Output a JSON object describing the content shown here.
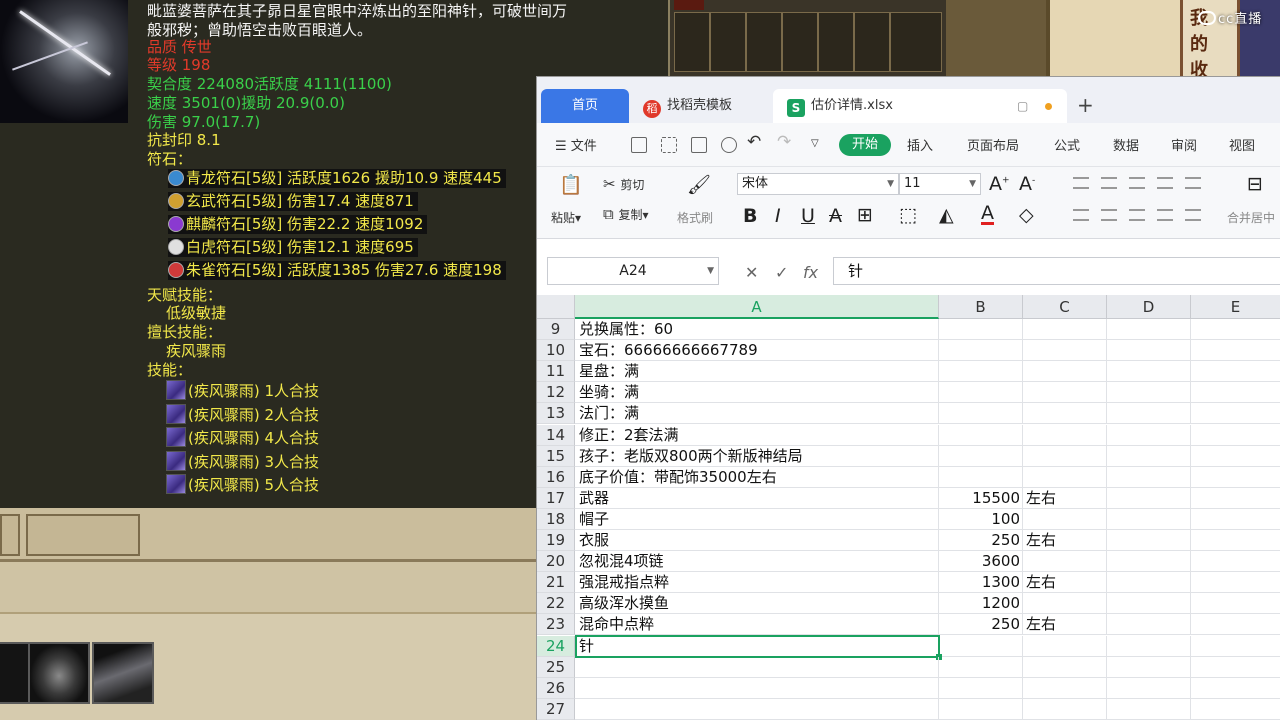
{
  "game": {
    "tooltip": {
      "desc_line1": "毗蓝婆菩萨在其子昴日星官眼中淬炼出的至阳神针，可破世间万",
      "desc_line2": "般邪秽；曾助悟空击败百眼道人。",
      "quality": "品质  传世",
      "level": "等级  198",
      "affinity": "契合度     224080活跃度  4111(1100)",
      "speed": "速度     3501(0)援助     20.9(0.0)",
      "damage": "伤害    97.0(17.7)",
      "resist_seal": "抗封印 8.1",
      "runes_label": "符石：",
      "runes": [
        {
          "text": "青龙符石[5级] 活跃度1626 援助10.9 速度445",
          "color": "#3a8ad0"
        },
        {
          "text": "玄武符石[5级] 伤害17.4 速度871",
          "color": "#d0a030"
        },
        {
          "text": "麒麟符石[5级] 伤害22.2 速度1092",
          "color": "#8a3ad0"
        },
        {
          "text": "白虎符石[5级] 伤害12.1 速度695",
          "color": "#e0e0e0"
        },
        {
          "text": "朱雀符石[5级] 活跃度1385 伤害27.6 速度198",
          "color": "#d03a3a"
        }
      ],
      "talent_label": "天赋技能：",
      "talent_value": "低级敏捷",
      "specialty_label": "擅长技能：",
      "specialty_value": "疾风骤雨",
      "skills_label": "技能：",
      "skills": [
        "(疾风骤雨) 1人合技",
        "(疾风骤雨) 2人合技",
        "(疾风骤雨) 4人合技",
        "(疾风骤雨) 3人合技",
        "(疾风骤雨) 5人合技"
      ]
    },
    "scroll_chars": [
      "我",
      "的",
      "收"
    ],
    "live_logo": "cc直播"
  },
  "wps": {
    "tabs": {
      "home": "首页",
      "templates": "找稻壳模板",
      "file": "估价详情.xlsx",
      "file_icon": "S",
      "templates_icon": "稻"
    },
    "menu": {
      "file": "文件",
      "start": "开始",
      "insert": "插入",
      "page_layout": "页面布局",
      "formula": "公式",
      "data": "数据",
      "review": "审阅",
      "view": "视图"
    },
    "ribbon": {
      "paste": "粘贴",
      "cut": "剪切",
      "copy": "复制",
      "format_painter": "格式刷",
      "font_name": "宋体",
      "font_size": "11",
      "merge": "合并居中"
    },
    "formula_bar": {
      "cell_ref": "A24",
      "content": "针"
    },
    "columns": [
      "A",
      "B",
      "C",
      "D",
      "E"
    ],
    "selected_column": "A",
    "rows": [
      {
        "num": "9",
        "a": "兑换属性：60",
        "b": "",
        "c": ""
      },
      {
        "num": "10",
        "a": "宝石：66666666667789",
        "b": "",
        "c": ""
      },
      {
        "num": "11",
        "a": "星盘：满",
        "b": "",
        "c": ""
      },
      {
        "num": "12",
        "a": "坐骑：满",
        "b": "",
        "c": ""
      },
      {
        "num": "13",
        "a": "法门：满",
        "b": "",
        "c": ""
      },
      {
        "num": "14",
        "a": "修正：2套法满",
        "b": "",
        "c": ""
      },
      {
        "num": "15",
        "a": "孩子：老版双800两个新版神结局",
        "b": "",
        "c": ""
      },
      {
        "num": "16",
        "a": "底子价值：带配饰35000左右",
        "b": "",
        "c": ""
      },
      {
        "num": "17",
        "a": "武器",
        "b": "15500",
        "c": "左右"
      },
      {
        "num": "18",
        "a": "帽子",
        "b": "100",
        "c": ""
      },
      {
        "num": "19",
        "a": "衣服",
        "b": "250",
        "c": "左右"
      },
      {
        "num": "20",
        "a": "忽视混4项链",
        "b": "3600",
        "c": ""
      },
      {
        "num": "21",
        "a": "强混戒指点粹",
        "b": "1300",
        "c": "左右"
      },
      {
        "num": "22",
        "a": "高级浑水摸鱼",
        "b": "1200",
        "c": ""
      },
      {
        "num": "23",
        "a": "混命中点粹",
        "b": "250",
        "c": "左右"
      },
      {
        "num": "24",
        "a": "针",
        "b": "",
        "c": ""
      },
      {
        "num": "25",
        "a": "",
        "b": "",
        "c": ""
      },
      {
        "num": "26",
        "a": "",
        "b": "",
        "c": ""
      },
      {
        "num": "27",
        "a": "",
        "b": "",
        "c": ""
      }
    ],
    "active_row": "24",
    "accent": "#1aa260",
    "tab_blue": "#3a77e6"
  }
}
